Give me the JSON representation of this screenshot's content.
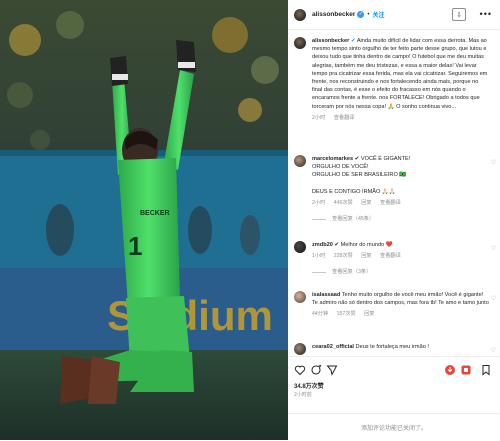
{
  "post": {
    "username": "alissonbecker",
    "follow_label": "关注",
    "caption_user": "alissonbecker",
    "caption_text": "Ainda muito difícil de lidar com essa derrota. Mas ao mesmo tempo sinto orgulho de ter feito parte desse grupo, que lutou e deixou tudo que tinha dentro de campo! O futebol que me deu muitas alegrias, também me deu tristezas, e essa a maior delas! Vai levar tempo pra cicatrizar essa ferida, mas ela vai cicatrizar. Seguiremos em frente, nos reconstruindo e nos fortalecendo ainda mais, porque no final das contas, é esse o efeito do fracasso em nós quando o encaramos frente a frente. nos FORTALECE! Obrigado a todos que torceram por nós nessa copa! 🙏 O sonho continua vivo...",
    "caption_time": "2小时",
    "caption_translate": "查看翻译",
    "photo_banner_text": "Stadium"
  },
  "comments": [
    {
      "username": "marcelomarkes",
      "lines": [
        "✔ VOCÊ É GIGANTE!",
        "ORGULHO DE VOCÊ!",
        "ORGULHO DE SER BRASILEIRO 🇧🇷",
        "",
        "DEUS E CONTIGO IRMÃO 🙏🏻🙏🏻"
      ],
      "time": "2小时",
      "likes": "446次赞",
      "reply": "回复",
      "translate": "查看翻译",
      "replies_label": "查看回复（45条）"
    },
    {
      "username": "zmdb20",
      "lines": [
        "✔ Melhor do mundo ❤️"
      ],
      "time": "1小时",
      "likes": "228次赞",
      "reply": "回复",
      "translate": "查看翻译",
      "replies_label": "查看回复（3条）"
    },
    {
      "username": "isalassaad",
      "lines": [
        "Tenho muito orgulho de você meu irmão! Você é gigante! Te admiro não só dentro dos campos, mas fora tb! Te amo e tamo junto"
      ],
      "time": "44分钟",
      "likes": "157次赞",
      "reply": "回复",
      "translate": "",
      "replies_label": ""
    },
    {
      "username": "ceara02_official",
      "lines": [
        "Deus te fortaleça meu irmão !"
      ],
      "time": "",
      "likes": "",
      "reply": "",
      "translate": "",
      "replies_label": ""
    }
  ],
  "actions": {
    "likes_count": "34.8万次赞",
    "posted_time": "2小时前",
    "comment_placeholder": "添加评论功能已关闭了。"
  },
  "icons": [
    "like-icon",
    "comment-icon",
    "share-icon",
    "bookmark-icon",
    "download-icon",
    "extension-icon",
    "more-icon"
  ],
  "colors": {
    "link_blue": "#0095f6",
    "verified_blue": "#3897f0",
    "muted": "#8e8e8e",
    "keeper_green": "#3fd05a"
  }
}
